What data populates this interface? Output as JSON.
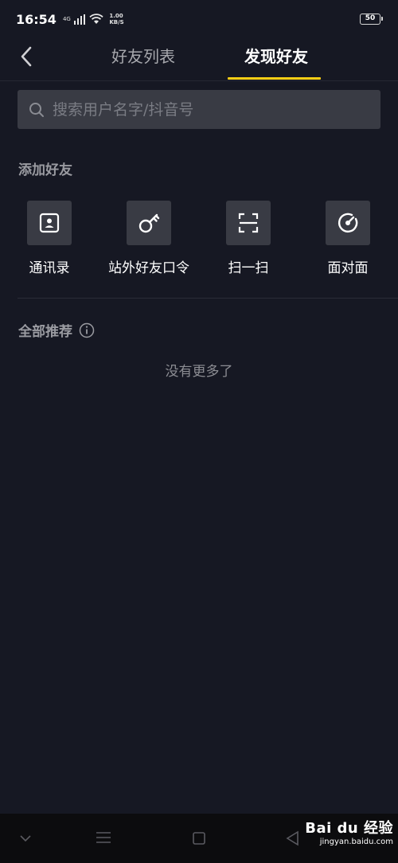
{
  "status": {
    "time": "16:54",
    "network": "4G",
    "speed_value": "1.00",
    "speed_unit": "KB/S",
    "battery": "50"
  },
  "nav": {
    "tabs": [
      {
        "label": "好友列表",
        "active": false
      },
      {
        "label": "发现好友",
        "active": true
      }
    ]
  },
  "search": {
    "placeholder": "搜索用户名字/抖音号",
    "value": ""
  },
  "add_friends": {
    "title": "添加好友",
    "actions": [
      {
        "label": "通讯录",
        "icon": "contacts-icon"
      },
      {
        "label": "站外好友口令",
        "icon": "key-icon"
      },
      {
        "label": "扫一扫",
        "icon": "scan-icon"
      },
      {
        "label": "面对面",
        "icon": "face-to-face-icon"
      }
    ]
  },
  "recommend": {
    "title": "全部推荐",
    "empty_text": "没有更多了"
  },
  "watermark": {
    "main": "Bai du 经验",
    "sub": "jingyan.baidu.com"
  },
  "colors": {
    "background": "#161823",
    "accent": "#face15",
    "tile": "#393b44"
  }
}
